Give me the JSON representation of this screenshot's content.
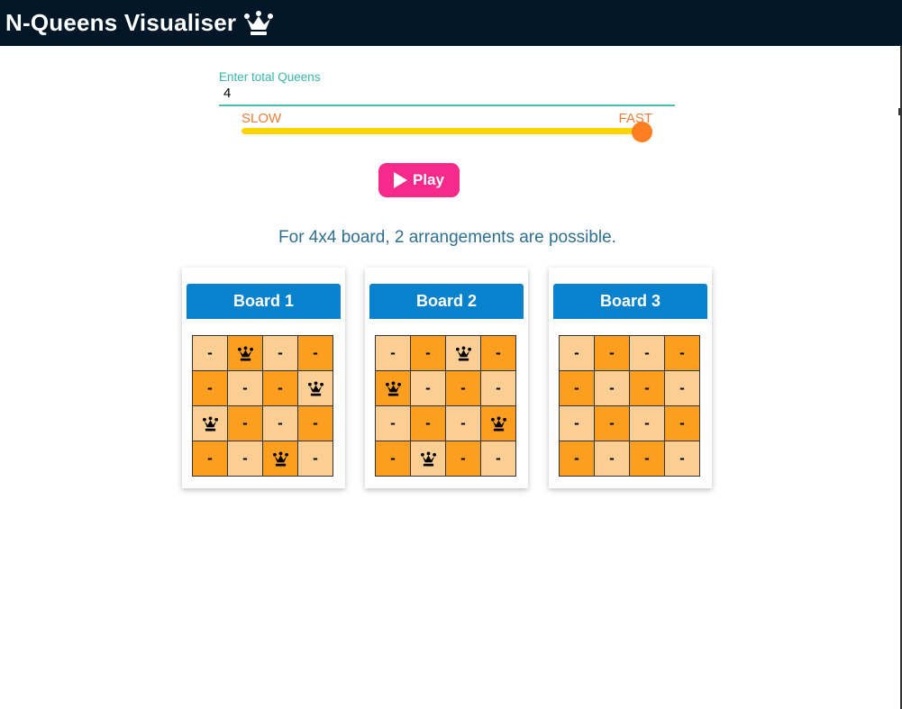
{
  "header": {
    "title": "N-Queens Visualiser",
    "icon": "crown-icon"
  },
  "queens_input": {
    "label": "Enter total Queens",
    "value": "4"
  },
  "speed": {
    "slow_label": "SLOW",
    "fast_label": "FAST",
    "level": 1.0
  },
  "play_button": {
    "label": "Play",
    "icon": "play-icon"
  },
  "summary": "For 4x4 board, 2 arrangements are possible.",
  "colors": {
    "header_bg": "#011627",
    "accent": "#4dc0b5",
    "speed_text": "#f47c34",
    "slider": "#ffd400",
    "thumb": "#fd7f20",
    "play": "#f72a8c",
    "board_header": "#0982cd",
    "cell_light": "#fbcf94",
    "cell_dark": "#fc9f20"
  },
  "boards": [
    {
      "title": "Board 1",
      "rows": [
        [
          "-",
          "Q",
          "-",
          "-"
        ],
        [
          "-",
          "-",
          "-",
          "Q"
        ],
        [
          "Q",
          "-",
          "-",
          "-"
        ],
        [
          "-",
          "-",
          "Q",
          "-"
        ]
      ]
    },
    {
      "title": "Board 2",
      "rows": [
        [
          "-",
          "-",
          "Q",
          "-"
        ],
        [
          "Q",
          "-",
          "-",
          "-"
        ],
        [
          "-",
          "-",
          "-",
          "Q"
        ],
        [
          "-",
          "Q",
          "-",
          "-"
        ]
      ]
    },
    {
      "title": "Board 3",
      "rows": [
        [
          "-",
          "-",
          "-",
          "-"
        ],
        [
          "-",
          "-",
          "-",
          "-"
        ],
        [
          "-",
          "-",
          "-",
          "-"
        ],
        [
          "-",
          "-",
          "-",
          "-"
        ]
      ]
    }
  ]
}
